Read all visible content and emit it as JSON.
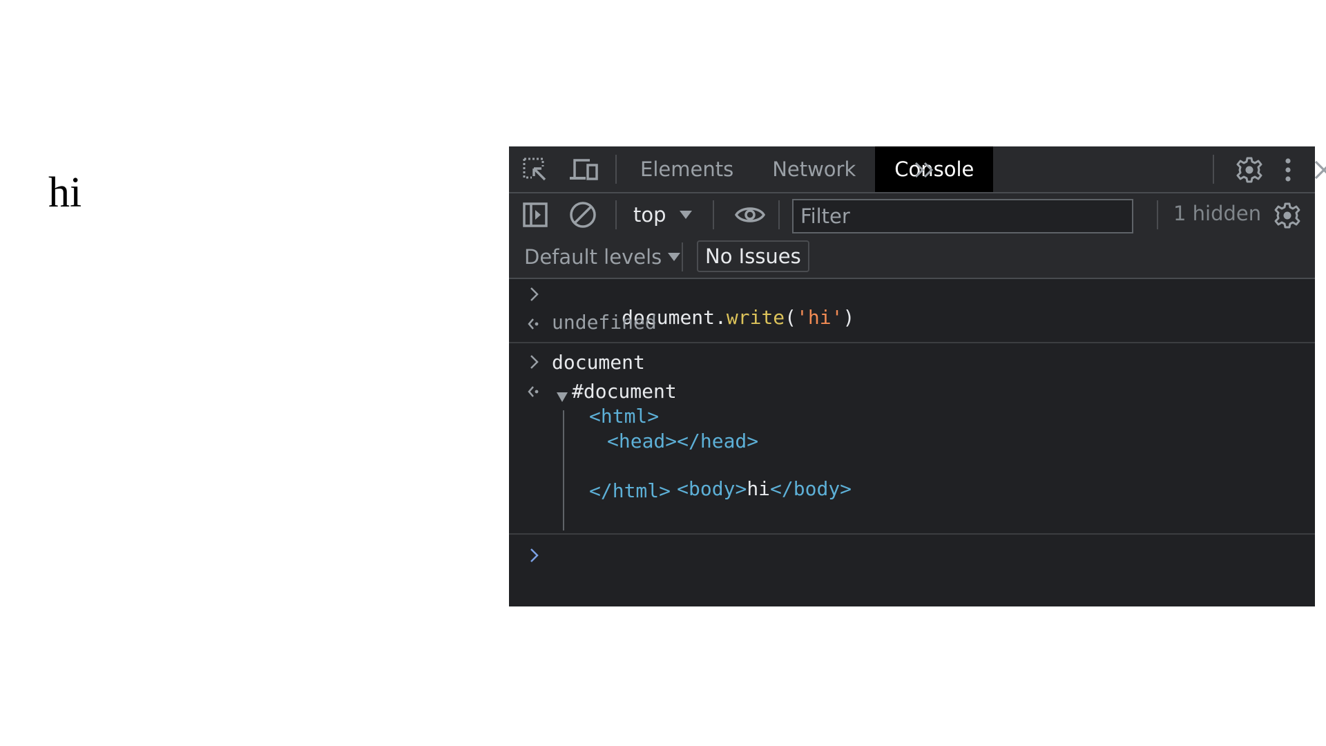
{
  "page": {
    "body_text": "hi"
  },
  "devtools": {
    "toolbar": {
      "inspect_icon": "inspect-element-icon",
      "device_icon": "device-toolbar-icon",
      "tabs": [
        {
          "label": "Elements",
          "active": false
        },
        {
          "label": "Network",
          "active": false
        },
        {
          "label": "Console",
          "active": true
        }
      ],
      "more_tabs_label": "»",
      "settings_icon": "gear-icon",
      "menu_icon": "kebab-menu-icon",
      "close_icon": "close-icon"
    },
    "console_toolbar": {
      "sidebar_icon": "sidebar-toggle-icon",
      "clear_icon": "clear-console-icon",
      "context_select": "top",
      "live_expression_icon": "eye-icon",
      "filter_placeholder": "Filter",
      "filter_value": "",
      "hidden_count": "1 hidden",
      "console_settings_icon": "gear-icon"
    },
    "levels_bar": {
      "levels_label": "Default levels",
      "issues_label": "No Issues"
    },
    "console": {
      "entries": [
        {
          "type": "input",
          "tokens": {
            "obj": "document",
            "dot": ".",
            "fn": "write",
            "open": "(",
            "str": "'hi'",
            "close": ")"
          }
        },
        {
          "type": "output",
          "text": "undefined"
        },
        {
          "type": "input",
          "text": "document"
        },
        {
          "type": "output-tree",
          "root": "#document",
          "children": [
            "<html>",
            "<head></head>",
            "<body>",
            "hi",
            "</body>",
            "</html>"
          ]
        }
      ],
      "prompt_icon": "prompt-chevron-icon"
    },
    "colors": {
      "panel_bg": "#202124",
      "toolbar_bg": "#292a2d",
      "active_tab_bg": "#000000",
      "function_color": "#dbc25a",
      "string_color": "#f28b54",
      "tag_color": "#5db0d7",
      "prompt_color": "#7ca1e6"
    }
  }
}
